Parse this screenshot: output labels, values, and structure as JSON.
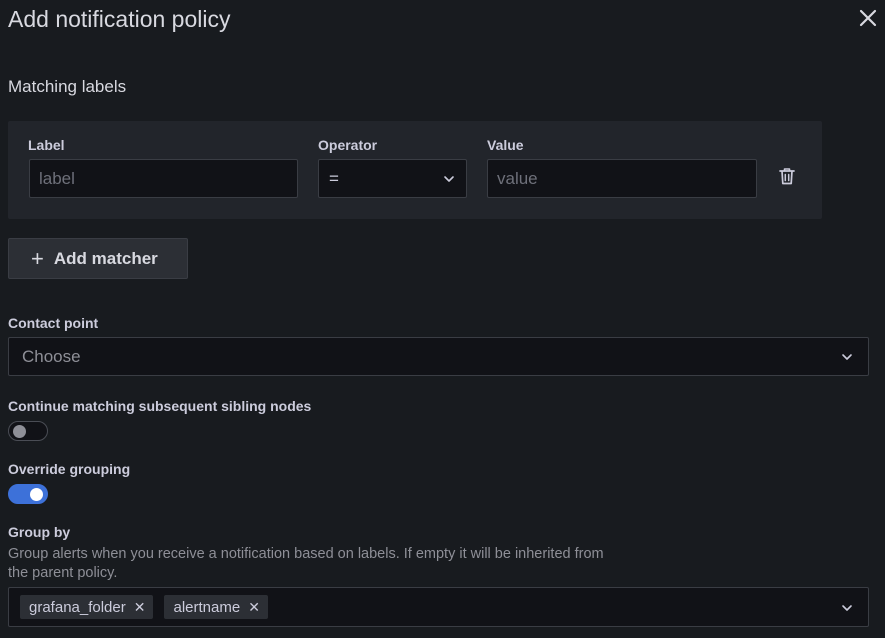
{
  "drawer": {
    "title": "Add notification policy",
    "close_icon": "close-icon"
  },
  "matching": {
    "section_title": "Matching labels",
    "label_header": "Label",
    "operator_header": "Operator",
    "value_header": "Value",
    "label_placeholder": "label",
    "operator_value": "=",
    "value_placeholder": "value",
    "delete_icon": "trash-icon",
    "add_button": "Add matcher"
  },
  "contact_point": {
    "label": "Contact point",
    "placeholder": "Choose"
  },
  "continue_matching": {
    "label": "Continue matching subsequent sibling nodes",
    "enabled": false
  },
  "override_grouping": {
    "label": "Override grouping",
    "enabled": true
  },
  "group_by": {
    "label": "Group by",
    "description": "Group alerts when you receive a notification based on labels. If empty it will be inherited from the parent policy.",
    "tags": [
      "grafana_folder",
      "alertname"
    ]
  },
  "colors": {
    "background": "#181b1f",
    "panel": "#22252b",
    "accent": "#3d71d9"
  }
}
